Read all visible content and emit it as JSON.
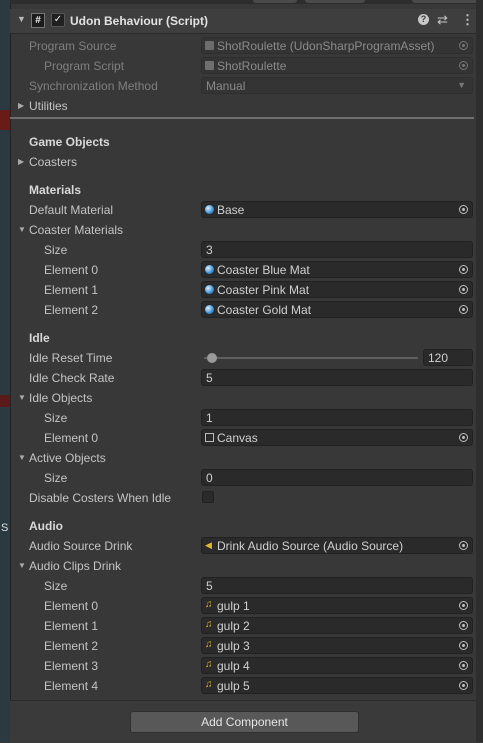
{
  "background_strip": {
    "label": "S"
  },
  "header": {
    "title": "Udon Behaviour (Script)",
    "enabled": true,
    "script_icon": "#",
    "fold_icon": "▼",
    "help_icon": "?",
    "preset_icon": "⇄",
    "menu_icon": "⋮"
  },
  "fields": {
    "program_source": {
      "label": "Program Source",
      "value": "ShotRoulette (UdonSharpProgramAsset)"
    },
    "program_script": {
      "label": "Program Script",
      "value": "ShotRoulette"
    },
    "sync_method": {
      "label": "Synchronization Method",
      "value": "Manual"
    },
    "utilities": {
      "label": "Utilities"
    }
  },
  "sections": {
    "game_objects": "Game Objects",
    "materials": "Materials",
    "idle": "Idle",
    "audio": "Audio"
  },
  "coasters": {
    "label": "Coasters"
  },
  "default_material": {
    "label": "Default Material",
    "value": "Base"
  },
  "coaster_materials": {
    "label": "Coaster Materials",
    "size_label": "Size",
    "size": "3",
    "elements": [
      {
        "label": "Element 0",
        "value": "Coaster Blue Mat"
      },
      {
        "label": "Element 1",
        "value": "Coaster Pink Mat"
      },
      {
        "label": "Element 2",
        "value": "Coaster Gold Mat"
      }
    ]
  },
  "idle_reset": {
    "label": "Idle Reset Time",
    "value": "120",
    "slider_fraction": 0.0
  },
  "idle_check": {
    "label": "Idle Check Rate",
    "value": "5"
  },
  "idle_objects": {
    "label": "Idle Objects",
    "size_label": "Size",
    "size": "1",
    "elements": [
      {
        "label": "Element 0",
        "value": "Canvas"
      }
    ]
  },
  "active_objects": {
    "label": "Active Objects",
    "size_label": "Size",
    "size": "0"
  },
  "disable_costers": {
    "label": "Disable Costers When Idle",
    "checked": false
  },
  "audio_source": {
    "label": "Audio Source Drink",
    "value": "Drink Audio Source (Audio Source)"
  },
  "audio_clips": {
    "label": "Audio Clips Drink",
    "size_label": "Size",
    "size": "5",
    "elements": [
      {
        "label": "Element 0",
        "value": "gulp 1"
      },
      {
        "label": "Element 1",
        "value": "gulp 2"
      },
      {
        "label": "Element 2",
        "value": "gulp 3"
      },
      {
        "label": "Element 3",
        "value": "gulp 4"
      },
      {
        "label": "Element 4",
        "value": "gulp 5"
      }
    ]
  },
  "add_component": {
    "label": "Add Component"
  },
  "icons": {
    "fold_open": "▼",
    "fold_closed": "▶",
    "dropdown_caret": "▼",
    "speaker": "◀",
    "music_note": "♫",
    "check": "✓"
  }
}
